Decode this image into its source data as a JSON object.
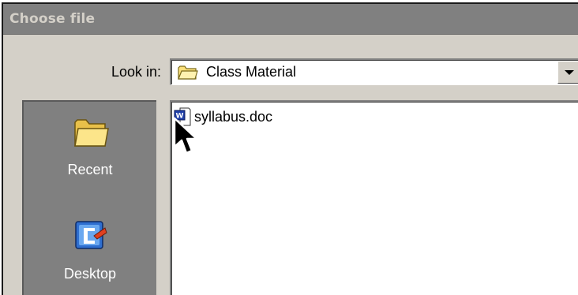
{
  "dialog": {
    "title": "Choose file"
  },
  "look_in": {
    "label": "Look in:",
    "value": "Class Material",
    "icon": "folder-icon"
  },
  "places": [
    {
      "label": "Recent",
      "icon": "recent-folder-icon"
    },
    {
      "label": "Desktop",
      "icon": "desktop-icon"
    }
  ],
  "files": [
    {
      "name": "syllabus.doc",
      "icon": "word-document-icon"
    }
  ],
  "colors": {
    "dialog_face": "#d4d0c8",
    "title_bar": "#808080",
    "places_bar": "#808080",
    "list_bg": "#ffffff"
  }
}
